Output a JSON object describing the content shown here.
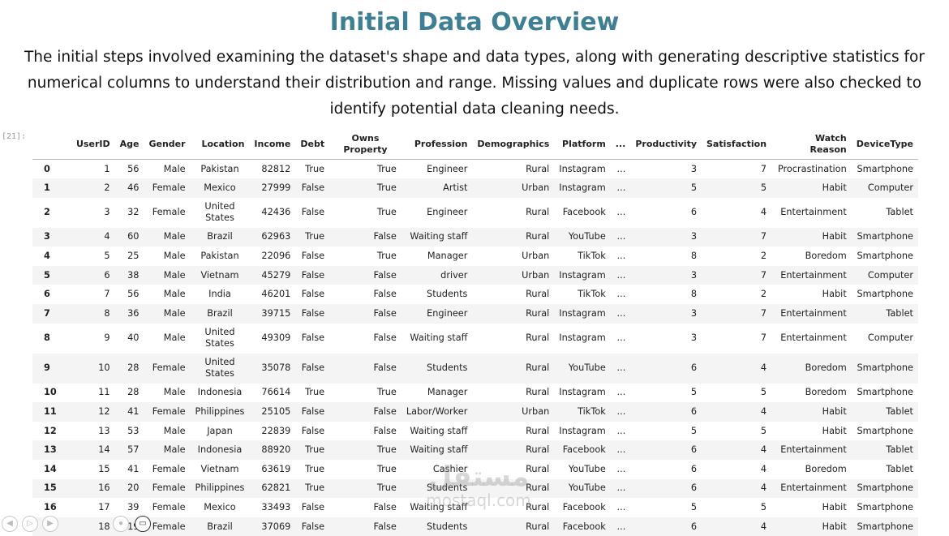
{
  "title": "Initial Data Overview",
  "description": "The initial steps involved examining the dataset's shape and data types, along with generating descriptive statistics for numerical columns to understand their distribution and range. Missing values and duplicate rows were also checked to identify potential data cleaning needs.",
  "cell_prompt": "[21]:",
  "columns": [
    "",
    "UserID",
    "Age",
    "Gender",
    "Location",
    "Income",
    "Debt",
    "Owns Property",
    "Profession",
    "Demographics",
    "Platform",
    "...",
    "Productivity",
    "Satisfaction",
    "Watch Reason",
    "DeviceType"
  ],
  "rows": [
    [
      "0",
      "1",
      "56",
      "Male",
      "Pakistan",
      "82812",
      "True",
      "True",
      "Engineer",
      "Rural",
      "Instagram",
      "...",
      "3",
      "7",
      "Procrastination",
      "Smartphone"
    ],
    [
      "1",
      "2",
      "46",
      "Female",
      "Mexico",
      "27999",
      "False",
      "True",
      "Artist",
      "Urban",
      "Instagram",
      "...",
      "5",
      "5",
      "Habit",
      "Computer"
    ],
    [
      "2",
      "3",
      "32",
      "Female",
      "United States",
      "42436",
      "False",
      "True",
      "Engineer",
      "Rural",
      "Facebook",
      "...",
      "6",
      "4",
      "Entertainment",
      "Tablet"
    ],
    [
      "3",
      "4",
      "60",
      "Male",
      "Brazil",
      "62963",
      "True",
      "False",
      "Waiting staff",
      "Rural",
      "YouTube",
      "...",
      "3",
      "7",
      "Habit",
      "Smartphone"
    ],
    [
      "4",
      "5",
      "25",
      "Male",
      "Pakistan",
      "22096",
      "False",
      "True",
      "Manager",
      "Urban",
      "TikTok",
      "...",
      "8",
      "2",
      "Boredom",
      "Smartphone"
    ],
    [
      "5",
      "6",
      "38",
      "Male",
      "Vietnam",
      "45279",
      "False",
      "False",
      "driver",
      "Urban",
      "Instagram",
      "...",
      "3",
      "7",
      "Entertainment",
      "Computer"
    ],
    [
      "6",
      "7",
      "56",
      "Male",
      "India",
      "46201",
      "False",
      "False",
      "Students",
      "Rural",
      "TikTok",
      "...",
      "8",
      "2",
      "Habit",
      "Smartphone"
    ],
    [
      "7",
      "8",
      "36",
      "Male",
      "Brazil",
      "39715",
      "False",
      "False",
      "Engineer",
      "Rural",
      "Instagram",
      "...",
      "3",
      "7",
      "Entertainment",
      "Tablet"
    ],
    [
      "8",
      "9",
      "40",
      "Male",
      "United States",
      "49309",
      "False",
      "False",
      "Waiting staff",
      "Rural",
      "Instagram",
      "...",
      "3",
      "7",
      "Entertainment",
      "Computer"
    ],
    [
      "9",
      "10",
      "28",
      "Female",
      "United States",
      "35078",
      "False",
      "False",
      "Students",
      "Rural",
      "YouTube",
      "...",
      "6",
      "4",
      "Boredom",
      "Smartphone"
    ],
    [
      "10",
      "11",
      "28",
      "Male",
      "Indonesia",
      "76614",
      "True",
      "True",
      "Manager",
      "Rural",
      "Instagram",
      "...",
      "5",
      "5",
      "Boredom",
      "Smartphone"
    ],
    [
      "11",
      "12",
      "41",
      "Female",
      "Philippines",
      "25105",
      "False",
      "False",
      "Labor/Worker",
      "Urban",
      "TikTok",
      "...",
      "6",
      "4",
      "Habit",
      "Tablet"
    ],
    [
      "12",
      "13",
      "53",
      "Male",
      "Japan",
      "22839",
      "False",
      "False",
      "Waiting staff",
      "Rural",
      "Instagram",
      "...",
      "5",
      "5",
      "Habit",
      "Smartphone"
    ],
    [
      "13",
      "14",
      "57",
      "Male",
      "Indonesia",
      "88920",
      "True",
      "True",
      "Waiting staff",
      "Rural",
      "Facebook",
      "...",
      "6",
      "4",
      "Entertainment",
      "Tablet"
    ],
    [
      "14",
      "15",
      "41",
      "Female",
      "Vietnam",
      "63619",
      "True",
      "True",
      "Cashier",
      "Rural",
      "YouTube",
      "...",
      "6",
      "4",
      "Boredom",
      "Tablet"
    ],
    [
      "15",
      "16",
      "20",
      "Female",
      "Philippines",
      "62821",
      "True",
      "True",
      "Students",
      "Rural",
      "YouTube",
      "...",
      "6",
      "4",
      "Entertainment",
      "Smartphone"
    ],
    [
      "16",
      "17",
      "39",
      "Female",
      "Mexico",
      "33493",
      "False",
      "False",
      "Waiting staff",
      "Rural",
      "Facebook",
      "...",
      "5",
      "5",
      "Habit",
      "Smartphone"
    ],
    [
      "17",
      "18",
      "19",
      "Female",
      "Brazil",
      "37069",
      "False",
      "False",
      "Students",
      "Rural",
      "Facebook",
      "...",
      "6",
      "4",
      "Habit",
      "Smartphone"
    ]
  ],
  "watermark": {
    "main": "مستقل",
    "sub": "mostaql.com"
  },
  "controls": [
    "prev-icon",
    "play-icon",
    "next-icon",
    "record-icon",
    "video-icon"
  ]
}
